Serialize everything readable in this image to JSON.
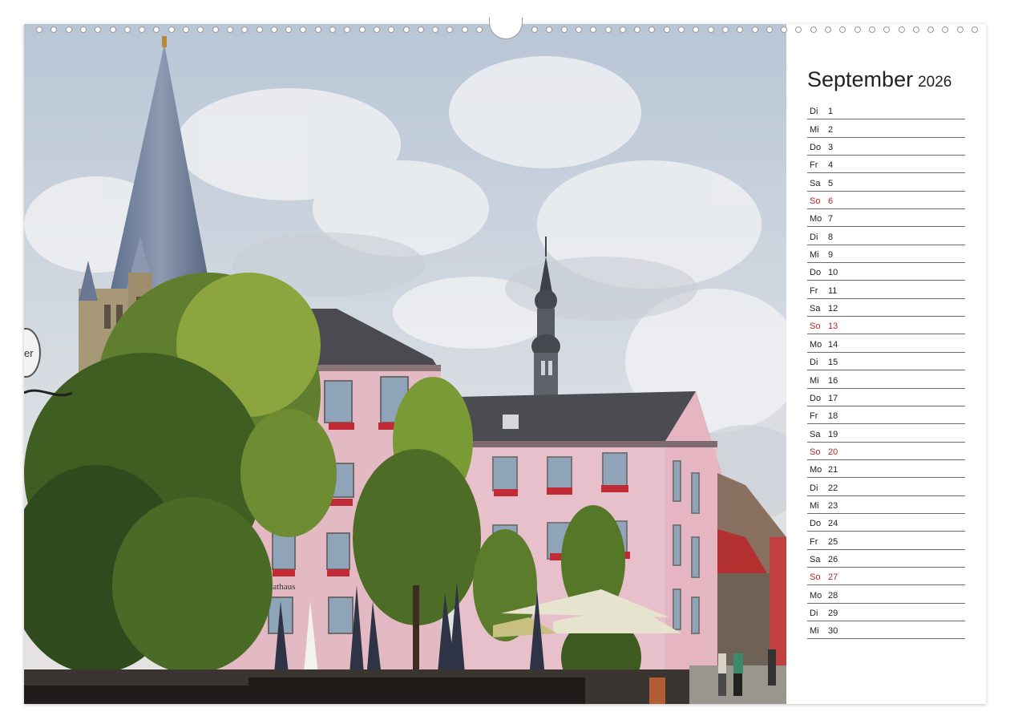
{
  "calendar": {
    "month": "September",
    "year": "2026",
    "days": [
      {
        "wd": "Di",
        "d": "1"
      },
      {
        "wd": "Mi",
        "d": "2"
      },
      {
        "wd": "Do",
        "d": "3"
      },
      {
        "wd": "Fr",
        "d": "4"
      },
      {
        "wd": "Sa",
        "d": "5"
      },
      {
        "wd": "So",
        "d": "6",
        "sunday": true
      },
      {
        "wd": "Mo",
        "d": "7"
      },
      {
        "wd": "Di",
        "d": "8"
      },
      {
        "wd": "Mi",
        "d": "9"
      },
      {
        "wd": "Do",
        "d": "10"
      },
      {
        "wd": "Fr",
        "d": "11"
      },
      {
        "wd": "Sa",
        "d": "12"
      },
      {
        "wd": "So",
        "d": "13",
        "sunday": true
      },
      {
        "wd": "Mo",
        "d": "14"
      },
      {
        "wd": "Di",
        "d": "15"
      },
      {
        "wd": "Mi",
        "d": "16"
      },
      {
        "wd": "Do",
        "d": "17"
      },
      {
        "wd": "Fr",
        "d": "18"
      },
      {
        "wd": "Sa",
        "d": "19"
      },
      {
        "wd": "So",
        "d": "20",
        "sunday": true
      },
      {
        "wd": "Mo",
        "d": "21"
      },
      {
        "wd": "Di",
        "d": "22"
      },
      {
        "wd": "Mi",
        "d": "23"
      },
      {
        "wd": "Do",
        "d": "24"
      },
      {
        "wd": "Fr",
        "d": "25"
      },
      {
        "wd": "Sa",
        "d": "26"
      },
      {
        "wd": "So",
        "d": "27",
        "sunday": true
      },
      {
        "wd": "Mo",
        "d": "28"
      },
      {
        "wd": "Di",
        "d": "29"
      },
      {
        "wd": "Mi",
        "d": "30"
      }
    ],
    "sunday_color": "#b3262a"
  },
  "photo": {
    "sign_rathaus": "Rathaus",
    "sign_left": "er"
  }
}
